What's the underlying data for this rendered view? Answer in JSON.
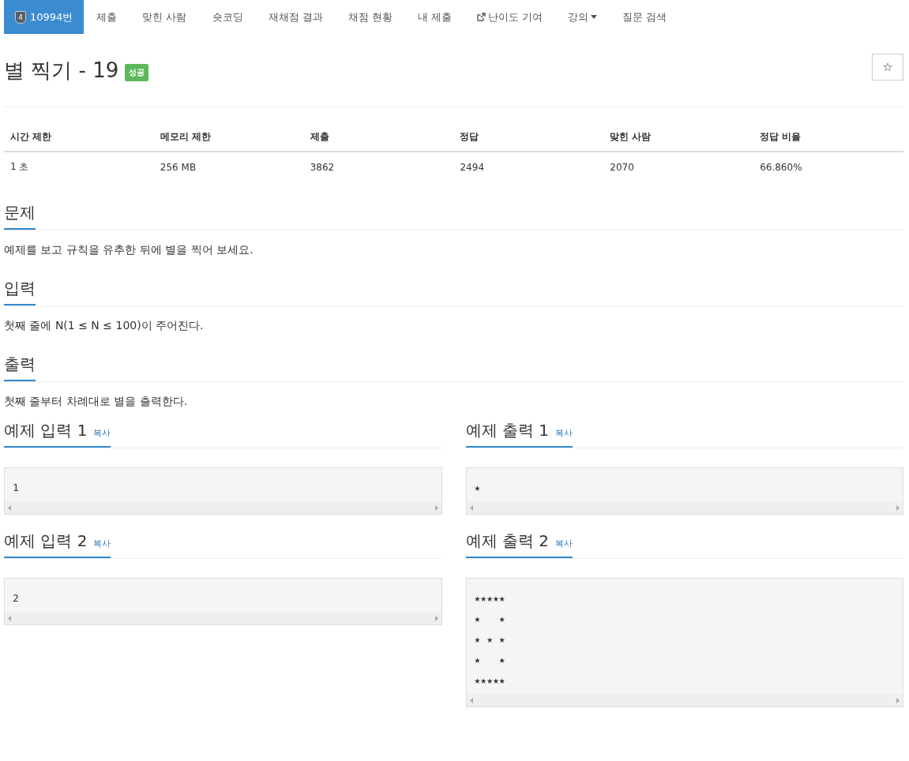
{
  "nav": [
    {
      "kind": "problem",
      "badge": "4",
      "label": "10994번",
      "selected": true
    },
    {
      "kind": "plain",
      "label": "제출",
      "selected": false
    },
    {
      "kind": "plain",
      "label": "맞힌 사람",
      "selected": false
    },
    {
      "kind": "plain",
      "label": "숏코딩",
      "selected": false
    },
    {
      "kind": "plain",
      "label": "재채점 결과",
      "selected": false
    },
    {
      "kind": "plain",
      "label": "채점 현황",
      "selected": false
    },
    {
      "kind": "plain",
      "label": "내 제출",
      "selected": false
    },
    {
      "kind": "external",
      "label": "난이도 기여",
      "selected": false
    },
    {
      "kind": "dropdown",
      "label": "강의",
      "selected": false
    },
    {
      "kind": "plain",
      "label": "질문 검색",
      "selected": false
    }
  ],
  "title": "별 찍기 - 19",
  "result_badge": "성공",
  "favorite": "☆",
  "stats": {
    "columns": [
      "시간 제한",
      "메모리 제한",
      "제출",
      "정답",
      "맞힌 사람",
      "정답 비율"
    ],
    "row": [
      "1 초",
      "256 MB",
      "3862",
      "2494",
      "2070",
      "66.860%"
    ]
  },
  "sections": [
    {
      "heading": "문제",
      "text": "예제를 보고 규칙을 유추한 뒤에 별을 찍어 보세요."
    },
    {
      "heading": "입력",
      "text": "첫째 줄에 N(1 ≤ N ≤ 100)이 주어진다."
    },
    {
      "heading": "출력",
      "text": "첫째 줄부터 차례대로 별을 출력한다."
    }
  ],
  "samples": [
    {
      "heading": "예제 입력 1",
      "copy": "복사",
      "lines": [
        "1"
      ]
    },
    {
      "heading": "예제 출력 1",
      "copy": "복사",
      "lines": [
        "★"
      ]
    },
    {
      "heading": "예제 입력 2",
      "copy": "복사",
      "lines": [
        "2"
      ]
    },
    {
      "heading": "예제 출력 2",
      "copy": "복사",
      "lines": [
        "★★★★★",
        "★   ★",
        "★ ★ ★",
        "★   ★",
        "★★★★★"
      ]
    }
  ]
}
